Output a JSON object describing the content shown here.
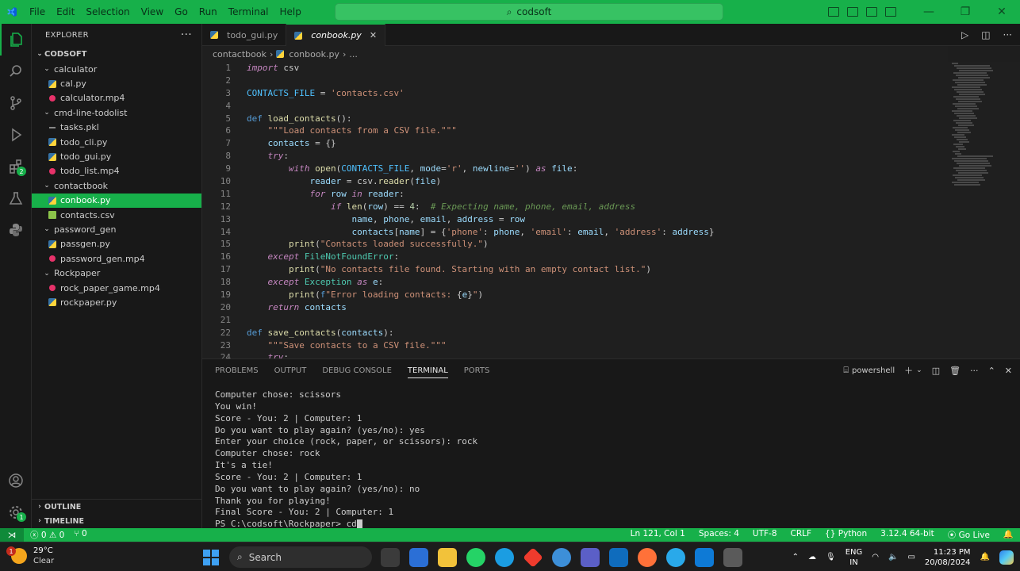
{
  "window": {
    "menu": [
      "File",
      "Edit",
      "Selection",
      "View",
      "Go",
      "Run",
      "Terminal",
      "Help"
    ],
    "search_text": "codsoft"
  },
  "explorer": {
    "title": "EXPLORER",
    "root": "CODSOFT",
    "tree": [
      {
        "label": "calculator",
        "type": "folder",
        "indent": 1
      },
      {
        "label": "cal.py",
        "type": "py",
        "indent": 2
      },
      {
        "label": "calculator.mp4",
        "type": "mp4",
        "indent": 2
      },
      {
        "label": "cmd-line-todolist",
        "type": "folder",
        "indent": 1
      },
      {
        "label": "tasks.pkl",
        "type": "pkl",
        "indent": 2
      },
      {
        "label": "todo_cli.py",
        "type": "py",
        "indent": 2
      },
      {
        "label": "todo_gui.py",
        "type": "py",
        "indent": 2
      },
      {
        "label": "todo_list.mp4",
        "type": "mp4",
        "indent": 2
      },
      {
        "label": "contactbook",
        "type": "folder",
        "indent": 1
      },
      {
        "label": "conbook.py",
        "type": "py",
        "indent": 2,
        "selected": true
      },
      {
        "label": "contacts.csv",
        "type": "csv",
        "indent": 2
      },
      {
        "label": "password_gen",
        "type": "folder",
        "indent": 1
      },
      {
        "label": "passgen.py",
        "type": "py",
        "indent": 2
      },
      {
        "label": "password_gen.mp4",
        "type": "mp4",
        "indent": 2
      },
      {
        "label": "Rockpaper",
        "type": "folder",
        "indent": 1
      },
      {
        "label": "rock_paper_game.mp4",
        "type": "mp4",
        "indent": 2
      },
      {
        "label": "rockpaper.py",
        "type": "py",
        "indent": 2
      }
    ],
    "outline": "OUTLINE",
    "timeline": "TIMELINE"
  },
  "tabs": [
    {
      "label": "todo_gui.py",
      "active": false
    },
    {
      "label": "conbook.py",
      "active": true
    }
  ],
  "breadcrumb": [
    "contactbook",
    "conbook.py",
    "..."
  ],
  "code_lines": [
    [
      [
        "kw",
        "import"
      ],
      [
        "t",
        " csv"
      ]
    ],
    [],
    [
      [
        "cst",
        "CONTACTS_FILE"
      ],
      [
        "t",
        " = "
      ],
      [
        "st",
        "'contacts.csv'"
      ]
    ],
    [],
    [
      [
        "kwb",
        "def"
      ],
      [
        "t",
        " "
      ],
      [
        "fn",
        "load_contacts"
      ],
      [
        "t",
        "():"
      ]
    ],
    [
      [
        "t",
        "    "
      ],
      [
        "st",
        "\"\"\"Load contacts from a CSV file.\"\"\""
      ]
    ],
    [
      [
        "t",
        "    "
      ],
      [
        "var",
        "contacts"
      ],
      [
        "t",
        " = {}"
      ]
    ],
    [
      [
        "t",
        "    "
      ],
      [
        "kw",
        "try"
      ],
      [
        "t",
        ":"
      ]
    ],
    [
      [
        "t",
        "        "
      ],
      [
        "kw",
        "with"
      ],
      [
        "t",
        " "
      ],
      [
        "fn",
        "open"
      ],
      [
        "t",
        "("
      ],
      [
        "cst",
        "CONTACTS_FILE"
      ],
      [
        "t",
        ", "
      ],
      [
        "var",
        "mode"
      ],
      [
        "t",
        "="
      ],
      [
        "st",
        "'r'"
      ],
      [
        "t",
        ", "
      ],
      [
        "var",
        "newline"
      ],
      [
        "t",
        "="
      ],
      [
        "st",
        "''"
      ],
      [
        "t",
        ") "
      ],
      [
        "kw",
        "as"
      ],
      [
        "t",
        " "
      ],
      [
        "var",
        "file"
      ],
      [
        "t",
        ":"
      ]
    ],
    [
      [
        "t",
        "            "
      ],
      [
        "var",
        "reader"
      ],
      [
        "t",
        " = csv."
      ],
      [
        "fn",
        "reader"
      ],
      [
        "t",
        "("
      ],
      [
        "var",
        "file"
      ],
      [
        "t",
        ")"
      ]
    ],
    [
      [
        "t",
        "            "
      ],
      [
        "kw",
        "for"
      ],
      [
        "t",
        " "
      ],
      [
        "var",
        "row"
      ],
      [
        "t",
        " "
      ],
      [
        "kw",
        "in"
      ],
      [
        "t",
        " "
      ],
      [
        "var",
        "reader"
      ],
      [
        "t",
        ":"
      ]
    ],
    [
      [
        "t",
        "                "
      ],
      [
        "kw",
        "if"
      ],
      [
        "t",
        " "
      ],
      [
        "fn",
        "len"
      ],
      [
        "t",
        "("
      ],
      [
        "var",
        "row"
      ],
      [
        "t",
        ") == "
      ],
      [
        "num",
        "4"
      ],
      [
        "t",
        ":  "
      ],
      [
        "cm",
        "# Expecting name, phone, email, address"
      ]
    ],
    [
      [
        "t",
        "                    "
      ],
      [
        "var",
        "name"
      ],
      [
        "t",
        ", "
      ],
      [
        "var",
        "phone"
      ],
      [
        "t",
        ", "
      ],
      [
        "var",
        "email"
      ],
      [
        "t",
        ", "
      ],
      [
        "var",
        "address"
      ],
      [
        "t",
        " = "
      ],
      [
        "var",
        "row"
      ]
    ],
    [
      [
        "t",
        "                    "
      ],
      [
        "var",
        "contacts"
      ],
      [
        "t",
        "["
      ],
      [
        "var",
        "name"
      ],
      [
        "t",
        "] = {"
      ],
      [
        "st",
        "'phone'"
      ],
      [
        "t",
        ": "
      ],
      [
        "var",
        "phone"
      ],
      [
        "t",
        ", "
      ],
      [
        "st",
        "'email'"
      ],
      [
        "t",
        ": "
      ],
      [
        "var",
        "email"
      ],
      [
        "t",
        ", "
      ],
      [
        "st",
        "'address'"
      ],
      [
        "t",
        ": "
      ],
      [
        "var",
        "address"
      ],
      [
        "t",
        "}"
      ]
    ],
    [
      [
        "t",
        "        "
      ],
      [
        "fn",
        "print"
      ],
      [
        "t",
        "("
      ],
      [
        "st",
        "\"Contacts loaded successfully.\""
      ],
      [
        "t",
        ")"
      ]
    ],
    [
      [
        "t",
        "    "
      ],
      [
        "kw",
        "except"
      ],
      [
        "t",
        " "
      ],
      [
        "cls",
        "FileNotFoundError"
      ],
      [
        "t",
        ":"
      ]
    ],
    [
      [
        "t",
        "        "
      ],
      [
        "fn",
        "print"
      ],
      [
        "t",
        "("
      ],
      [
        "st",
        "\"No contacts file found. Starting with an empty contact list.\""
      ],
      [
        "t",
        ")"
      ]
    ],
    [
      [
        "t",
        "    "
      ],
      [
        "kw",
        "except"
      ],
      [
        "t",
        " "
      ],
      [
        "cls",
        "Exception"
      ],
      [
        "t",
        " "
      ],
      [
        "kw",
        "as"
      ],
      [
        "t",
        " "
      ],
      [
        "var",
        "e"
      ],
      [
        "t",
        ":"
      ]
    ],
    [
      [
        "t",
        "        "
      ],
      [
        "fn",
        "print"
      ],
      [
        "t",
        "("
      ],
      [
        "kwb",
        "f"
      ],
      [
        "st",
        "\"Error loading contacts: "
      ],
      [
        "t",
        "{"
      ],
      [
        "var",
        "e"
      ],
      [
        "t",
        "}"
      ],
      [
        "st",
        "\""
      ],
      [
        "t",
        ")"
      ]
    ],
    [
      [
        "t",
        "    "
      ],
      [
        "kw",
        "return"
      ],
      [
        "t",
        " "
      ],
      [
        "var",
        "contacts"
      ]
    ],
    [],
    [
      [
        "kwb",
        "def"
      ],
      [
        "t",
        " "
      ],
      [
        "fn",
        "save_contacts"
      ],
      [
        "t",
        "("
      ],
      [
        "var",
        "contacts"
      ],
      [
        "t",
        "):"
      ]
    ],
    [
      [
        "t",
        "    "
      ],
      [
        "st",
        "\"\"\"Save contacts to a CSV file.\"\"\""
      ]
    ],
    [
      [
        "t",
        "    "
      ],
      [
        "kw",
        "try"
      ],
      [
        "t",
        ":"
      ]
    ]
  ],
  "panel": {
    "tabs": [
      "PROBLEMS",
      "OUTPUT",
      "DEBUG CONSOLE",
      "TERMINAL",
      "PORTS"
    ],
    "active_tab": "TERMINAL",
    "shell": "powershell",
    "terminal_lines": [
      "Computer chose: scissors",
      "You win!",
      "Score - You: 2 | Computer: 1",
      "Do you want to play again? (yes/no): yes",
      "Enter your choice (rock, paper, or scissors): rock",
      "Computer chose: rock",
      "It's a tie!",
      "Score - You: 2 | Computer: 1",
      "Do you want to play again? (yes/no): no",
      "Thank you for playing!",
      "Final Score - You: 2 | Computer: 1",
      "PS C:\\codsoft\\Rockpaper> cd"
    ]
  },
  "statusbar": {
    "errors": "0",
    "warnings": "0",
    "ports": "0",
    "position": "Ln 121, Col 1",
    "spaces": "Spaces: 4",
    "encoding": "UTF-8",
    "eol": "CRLF",
    "language": "Python",
    "interpreter": "3.12.4 64-bit",
    "golive": "Go Live"
  },
  "taskbar": {
    "temp": "29°C",
    "weather": "Clear",
    "weather_badge": "1",
    "search": "Search",
    "lang1": "ENG",
    "lang2": "IN",
    "time": "11:23 PM",
    "date": "20/08/2024"
  },
  "colors": {
    "accent": "#17b04a",
    "editor_bg": "#1f1f1f",
    "sidebar_bg": "#181818"
  }
}
